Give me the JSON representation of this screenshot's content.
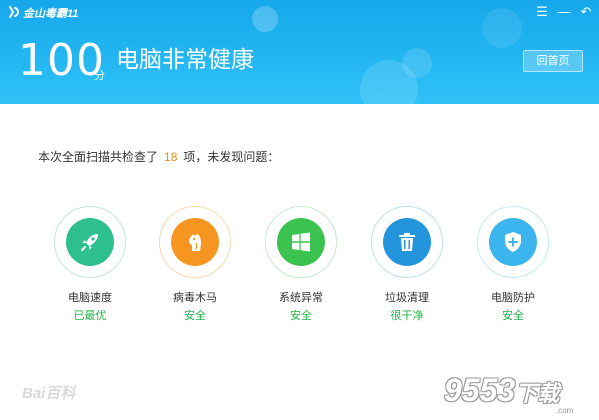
{
  "app": {
    "title": "金山毒霸11"
  },
  "window_controls": {
    "menu": "☰",
    "minimize": "—",
    "back": "↶"
  },
  "header": {
    "score": "100",
    "score_unit": "分",
    "status": "电脑非常健康",
    "home_button": "回首页"
  },
  "summary": {
    "prefix": "本次全面扫描共检查了",
    "count": "18",
    "suffix": "项，未发现问题："
  },
  "items": [
    {
      "label": "电脑速度",
      "status": "已最优",
      "icon": "rocket-icon",
      "color": "#2dbf8e"
    },
    {
      "label": "病毒木马",
      "status": "安全",
      "icon": "horse-icon",
      "color": "#f6951f"
    },
    {
      "label": "系统异常",
      "status": "安全",
      "icon": "windows-icon",
      "color": "#3cc24f"
    },
    {
      "label": "垃圾清理",
      "status": "很干净",
      "icon": "trash-icon",
      "color": "#2495dc"
    },
    {
      "label": "电脑防护",
      "status": "安全",
      "icon": "shield-icon",
      "color": "#3cb5ee"
    }
  ],
  "colors": {
    "header": "#23b6f2",
    "accent_count": "#f08a1c",
    "status_ok": "#22b34a"
  },
  "watermarks": {
    "left": "Bai百科",
    "right_number": "9553",
    "right_text": "下载",
    "right_domain": ".com"
  }
}
